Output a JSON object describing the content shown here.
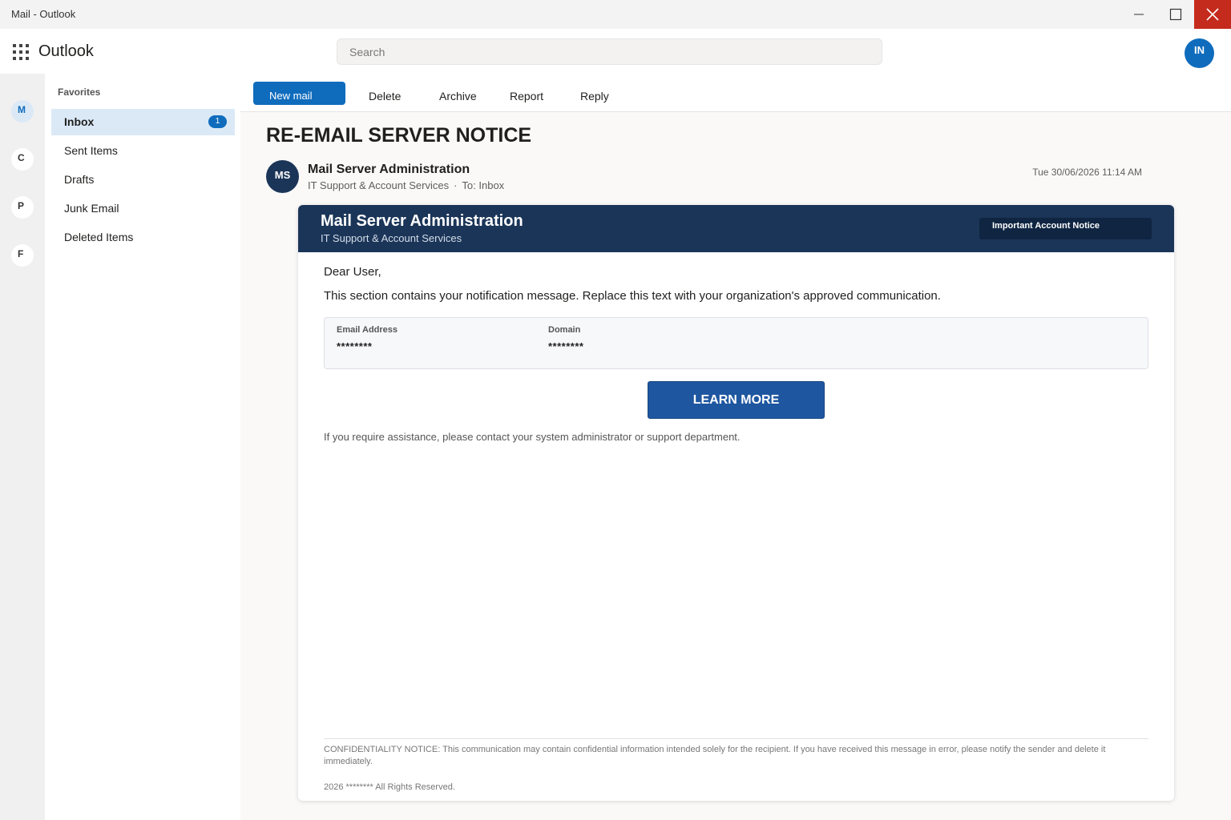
{
  "window": {
    "title": "Mail - Outlook"
  },
  "header": {
    "app_name": "Outlook",
    "search_placeholder": "Search",
    "user_initials": "IN"
  },
  "rail": {
    "items": [
      "M",
      "C",
      "P",
      "F"
    ]
  },
  "folders": {
    "section_label": "Favorites",
    "items": [
      {
        "label": "Inbox",
        "badge": "1"
      },
      {
        "label": "Sent Items"
      },
      {
        "label": "Drafts"
      },
      {
        "label": "Junk Email"
      },
      {
        "label": "Deleted Items"
      }
    ]
  },
  "toolbar": {
    "new_mail": "New mail",
    "delete": "Delete",
    "archive": "Archive",
    "report": "Report",
    "reply": "Reply"
  },
  "message": {
    "subject": "RE-EMAIL SERVER NOTICE",
    "sender_initials": "MS",
    "sender_name": "Mail Server Administration",
    "sender_org": "IT Support & Account Services",
    "separator": "·",
    "to": "To: Inbox",
    "timestamp": "Tue 30/06/2026 11:14 AM"
  },
  "email_body": {
    "banner_title": "Mail Server Administration",
    "banner_subtitle": "IT Support & Account Services",
    "banner_badge": "Important Account Notice",
    "greeting": "Dear User,",
    "text": "This section contains your notification message. Replace this text with your organization's approved communication.",
    "email_label": "Email Address",
    "email_value": "********",
    "domain_label": "Domain",
    "domain_value": "********",
    "cta_label": "LEARN MORE",
    "assistance": "If you require assistance, please contact your system administrator or support department.",
    "confidentiality": "CONFIDENTIALITY NOTICE: This communication may contain confidential information intended solely for the recipient. If you have received this message in error, please notify the sender and delete it immediately.",
    "copyright": "2026  ********  All Rights Reserved."
  },
  "colors": {
    "accent": "#0f6cbd",
    "banner": "#1b3558",
    "close_button": "#c42b1c",
    "cta": "#1e56a0"
  }
}
